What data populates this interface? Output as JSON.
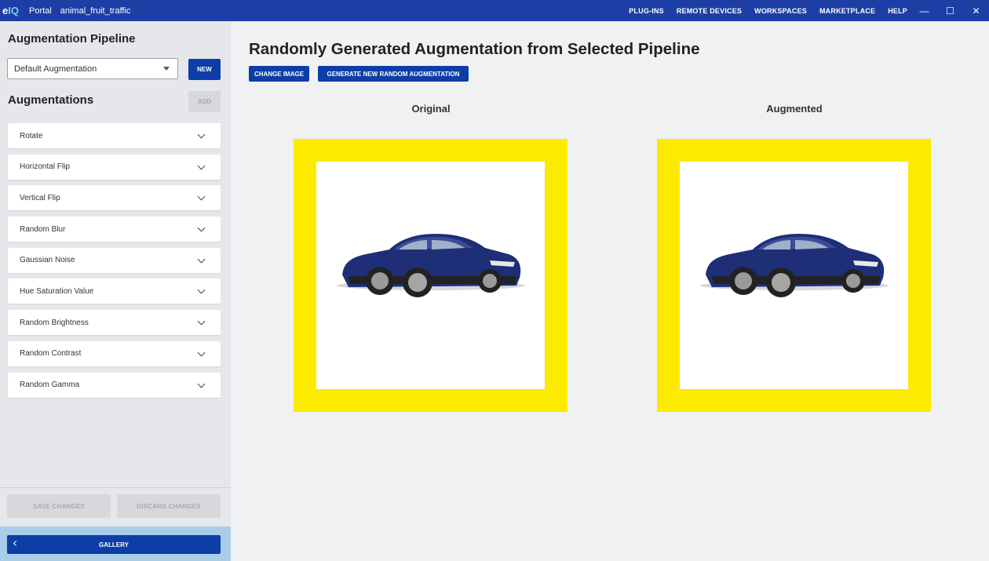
{
  "titlebar": {
    "logo_e": "e",
    "logo_iq": "IQ",
    "portal": "Portal",
    "project": "animal_fruit_traffic",
    "menu": [
      "PLUG-INS",
      "REMOTE DEVICES",
      "WORKSPACES",
      "MARKETPLACE",
      "HELP"
    ],
    "window_controls": [
      "—",
      "☐",
      "✕"
    ]
  },
  "sidebar": {
    "title": "Augmentation Pipeline",
    "pipeline_select": "Default Augmentation",
    "new_label": "NEW",
    "augmentations_title": "Augmentations",
    "add_label": "ADD",
    "augmentations": [
      "Rotate",
      "Horizontal Flip",
      "Vertical Flip",
      "Random Blur",
      "Gaussian Noise",
      "Hue Saturation Value",
      "Random Brightness",
      "Random Contrast",
      "Random Gamma"
    ],
    "save_label": "SAVE CHANGES",
    "discard_label": "DISCARD CHANGES",
    "gallery_label": "GALLERY"
  },
  "main": {
    "title": "Randomly Generated Augmentation from Selected Pipeline",
    "change_image_label": "CHANGE IMAGE",
    "generate_label": "GENERATE NEW RANDOM AUGMENTATION",
    "original_label": "Original",
    "augmented_label": "Augmented"
  },
  "colors": {
    "titlebar": "#1d3fa5",
    "primary_button": "#0d3ea8",
    "frame_yellow": "#fcea00",
    "gallery_bar": "#a9cde9"
  }
}
